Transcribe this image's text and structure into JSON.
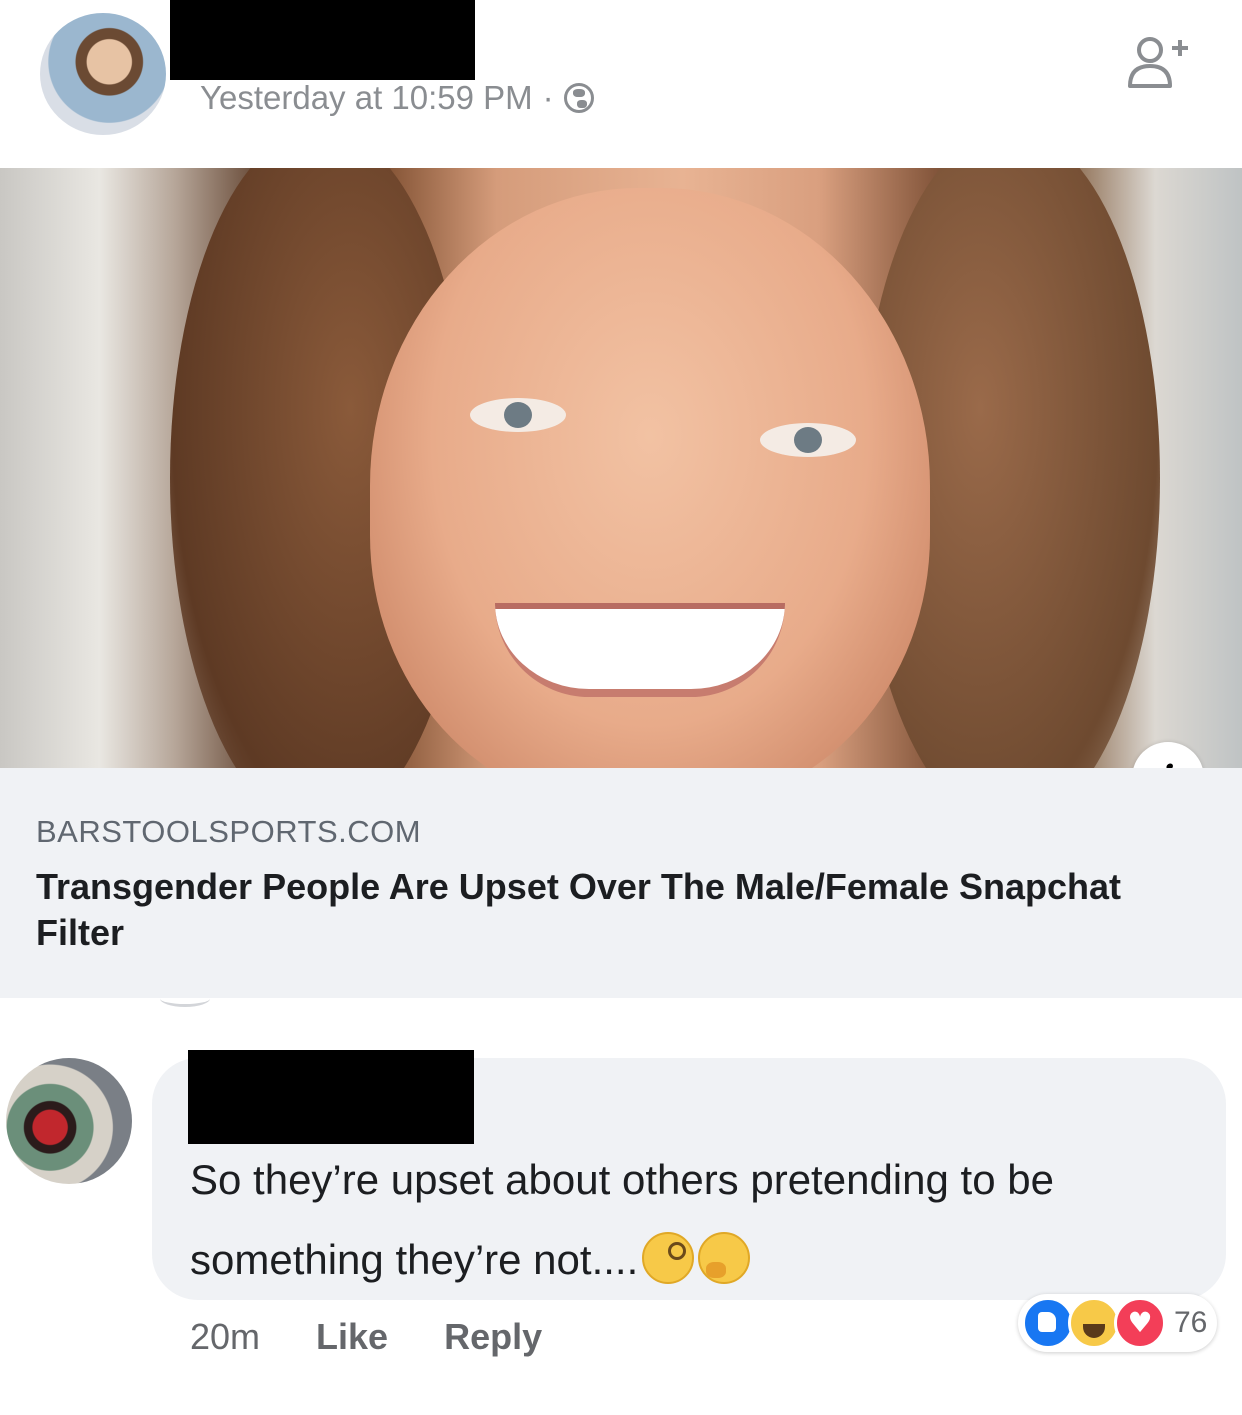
{
  "post": {
    "timestamp": "Yesterday at 10:59 PM",
    "separator": "·",
    "privacy_icon": "globe-icon",
    "header_action_icon": "add-friend-icon"
  },
  "link_preview": {
    "domain": "BARSTOOLSPORTS.COM",
    "headline": "Transgender People Are Upset Over The Male/Female Snapchat Filter",
    "info_icon": "i"
  },
  "comment": {
    "text": "So they’re upset about others pretending to be something they’re not....",
    "emojis": [
      "face-with-monocle-emoji",
      "thinking-face-emoji"
    ],
    "time": "20m",
    "like_label": "Like",
    "reply_label": "Reply",
    "reactions": [
      "like",
      "haha",
      "love"
    ],
    "reaction_count": "76"
  },
  "colors": {
    "meta_gray": "#8a8d91",
    "bubble_bg": "#f0f2f5",
    "like_blue": "#1877f2",
    "love_red": "#f33e58"
  }
}
